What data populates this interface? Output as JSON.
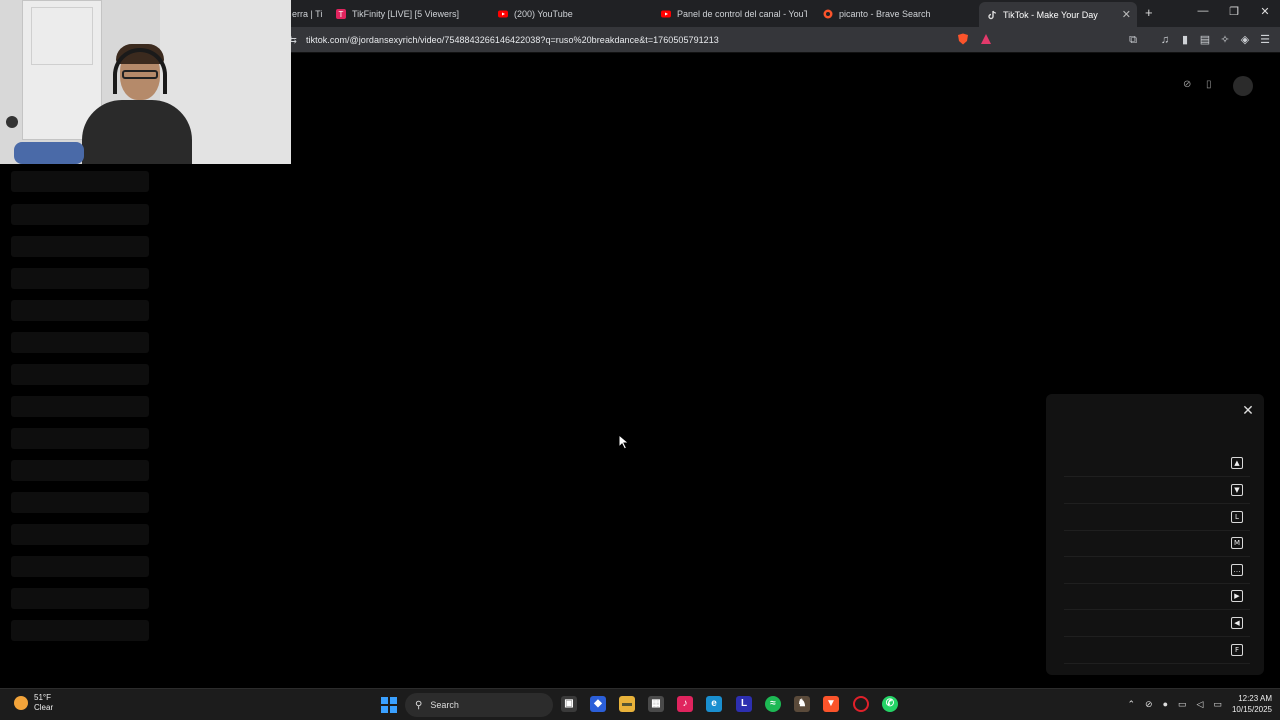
{
  "browser": {
    "tabs": [
      {
        "label": "erra | Ti",
        "favicon": "tab-icon"
      },
      {
        "label": "TikFinity [LIVE] [5 Viewers]",
        "favicon": "tikfinity-icon",
        "color": "#e0245e"
      },
      {
        "label": "(200) YouTube",
        "favicon": "youtube-icon",
        "color": "#ff0000"
      },
      {
        "label": "Panel de control del canal - YouTube",
        "favicon": "youtube-studio-icon",
        "color": "#ff0000"
      },
      {
        "label": "picanto - Brave Search",
        "favicon": "brave-search-icon",
        "color": "#fb542b"
      },
      {
        "label": "TikTok - Make Your Day",
        "favicon": "tiktok-icon",
        "active": true
      }
    ],
    "url": "tiktok.com/@jordansexyrich/video/7548843266146422038?q=ruso%20breakdance&t=1760505791213"
  },
  "shortcuts_panel": {
    "keys": [
      {
        "glyph": "▲",
        "icon": "arrow-up-key-icon"
      },
      {
        "glyph": "▼",
        "icon": "arrow-down-key-icon"
      },
      {
        "glyph": "L",
        "icon": "l-key-icon"
      },
      {
        "glyph": "M",
        "icon": "m-key-icon"
      },
      {
        "glyph": "…",
        "icon": "captions-key-icon"
      },
      {
        "glyph": "▶",
        "icon": "arrow-right-key-icon"
      },
      {
        "glyph": "◀",
        "icon": "arrow-left-key-icon"
      },
      {
        "glyph": "F",
        "icon": "f-key-icon"
      }
    ]
  },
  "taskbar": {
    "weather_temp": "51°F",
    "weather_desc": "Clear",
    "search_placeholder": "Search",
    "time": "12:23 AM",
    "date": "10/15/2025",
    "apps": [
      "windows-start-icon",
      "file-explorer-icon",
      "copilot-icon",
      "folder-icon",
      "store-icon",
      "tiktok-app-icon",
      "edge-icon",
      "l-app-icon",
      "spotify-icon",
      "game-icon",
      "brave-icon",
      "opera-icon",
      "whatsapp-icon"
    ]
  },
  "colors": {
    "accent": "#3aa0ff",
    "background": "#000000",
    "panel": "#121212"
  }
}
